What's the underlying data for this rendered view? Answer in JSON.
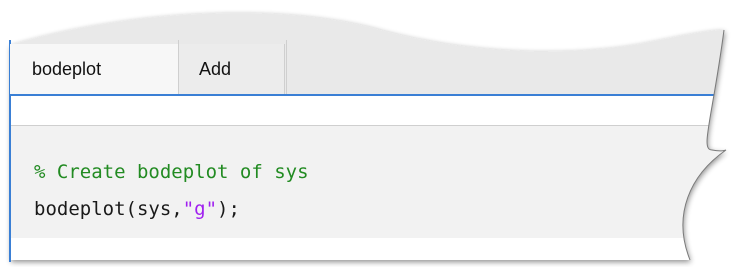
{
  "tabs": [
    {
      "label": "bodeplot",
      "active": true
    },
    {
      "label": "Add",
      "active": false
    }
  ],
  "code": {
    "comment": "% Create bodeplot of sys",
    "line2_prefix": "bodeplot(sys,",
    "line2_string": "\"g\"",
    "line2_suffix": ");"
  },
  "colors": {
    "comment": "#228b22",
    "string": "#a020f0",
    "code": "#1a1a1a",
    "tab_underline": "#3a7fd5",
    "code_background": "#f2f2f2"
  }
}
